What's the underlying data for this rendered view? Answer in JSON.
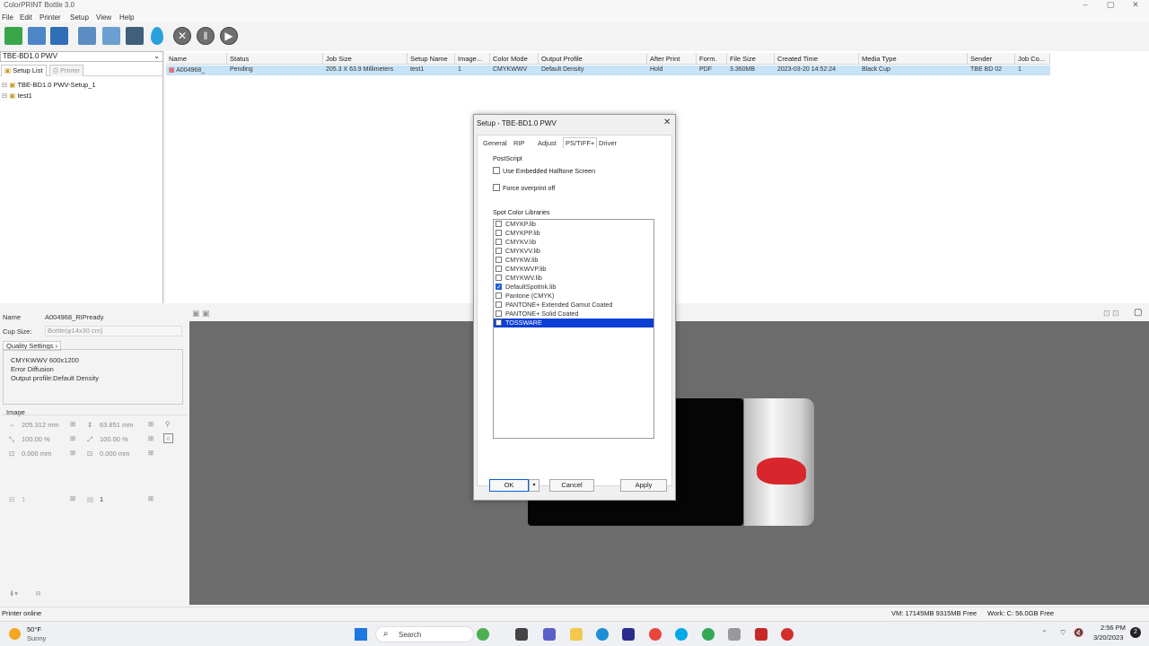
{
  "window": {
    "title": "ColorPRINT Bottle 3.0",
    "controls": [
      "–",
      "▢",
      "✕"
    ]
  },
  "menu": [
    "File",
    "Edit",
    "Printer",
    "Setup",
    "View",
    "Help"
  ],
  "left": {
    "device": "TBE-BD1.0 PWV",
    "tabs": [
      "Setup List",
      "Printer"
    ],
    "tree": [
      "TBE-BD1.0 PWV-Setup_1",
      "test1"
    ]
  },
  "grid": {
    "headers": [
      "Name",
      "Status",
      "Job Size",
      "Setup Name",
      "Image...",
      "Color Mode",
      "Output Profile",
      "After Print",
      "Form.",
      "File Size",
      "Created Time",
      "Media Type",
      "Sender",
      "Job Co..."
    ],
    "row": [
      "A004968_",
      "Pending",
      "205.3 X 63.9 Millimeters",
      "test1",
      "1",
      "CMYKWWV",
      "Default Density",
      "Hold",
      "PDF",
      "3.360MB",
      "2023-03-20 14:52:24",
      "Black Cup",
      "TBE BD 02",
      "1"
    ]
  },
  "props": {
    "name_label": "Name",
    "name_value": "A004968_RIPready",
    "cup_label": "Cup Size:",
    "cup_value": "Bottle(φ14x30 cm)",
    "quality_label": "Quality Settings",
    "quality_lines": [
      "CMYKWWV    600x1200",
      "Error Diffusion",
      "Output profile:Default Density"
    ],
    "image_label": "Image",
    "width": "205.312 mm",
    "height": "63.851 mm",
    "scale_x": "100.00 %",
    "scale_y": "100.00 %",
    "offset_x": "0.000 mm",
    "offset_y": "0.000 mm",
    "copies_a": "1",
    "copies_b": "1"
  },
  "dialog": {
    "title": "Setup - TBE-BD1.0 PWV",
    "tabs": [
      "General",
      "RIP",
      "Adjust",
      "PS/TIFF+",
      "Driver"
    ],
    "postscript_label": "PostScript",
    "opt1": "Use Embedded Halftone Screen",
    "opt2": "Force overprint off",
    "libraries_label": "Spot Color Libraries",
    "libraries": [
      {
        "name": "CMYKP.lib",
        "checked": false,
        "selected": false
      },
      {
        "name": "CMYKPP.lib",
        "checked": false,
        "selected": false
      },
      {
        "name": "CMYKV.lib",
        "checked": false,
        "selected": false
      },
      {
        "name": "CMYKVV.lib",
        "checked": false,
        "selected": false
      },
      {
        "name": "CMYKW.lib",
        "checked": false,
        "selected": false
      },
      {
        "name": "CMYKWVP.lib",
        "checked": false,
        "selected": false
      },
      {
        "name": "CMYKWV.lib",
        "checked": false,
        "selected": false
      },
      {
        "name": "DefaultSpotInk.lib",
        "checked": true,
        "selected": false
      },
      {
        "name": "Pantone (CMYK)",
        "checked": false,
        "selected": false
      },
      {
        "name": "PANTONE+ Extended Gamut Coated",
        "checked": false,
        "selected": false
      },
      {
        "name": "PANTONE+ Solid Coated",
        "checked": false,
        "selected": false
      },
      {
        "name": "TOSSWARE",
        "checked": false,
        "selected": true
      }
    ],
    "ok": "OK",
    "cancel": "Cancel",
    "apply": "Apply"
  },
  "status": {
    "left": "Printer online",
    "vm": "VM: 17145MB 9315MB Free",
    "work": "Work: C: 56.0GB Free"
  },
  "taskbar": {
    "weather_temp": "50°F",
    "weather_text": "Sunny",
    "search": "Search",
    "time": "2:56 PM",
    "date": "3/20/2023"
  },
  "colors": {
    "selection": "#0a3fd4",
    "row_highlight": "#c7e3f7",
    "preview_bg": "#6c6c6c"
  }
}
